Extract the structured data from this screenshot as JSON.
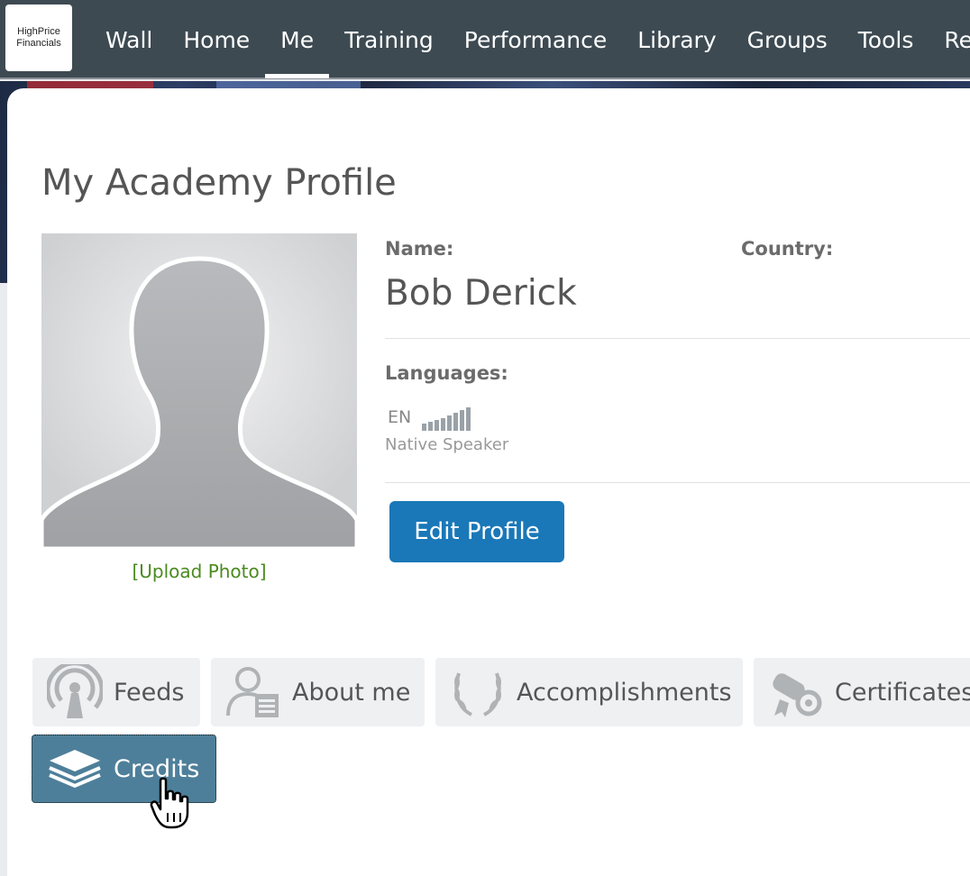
{
  "logo": {
    "line1": "HighPrice",
    "line2": "Financials"
  },
  "nav": {
    "items": [
      {
        "label": "Wall",
        "active": false
      },
      {
        "label": "Home",
        "active": false
      },
      {
        "label": "Me",
        "active": true
      },
      {
        "label": "Training",
        "active": false
      },
      {
        "label": "Performance",
        "active": false
      },
      {
        "label": "Library",
        "active": false
      },
      {
        "label": "Groups",
        "active": false
      },
      {
        "label": "Tools",
        "active": false
      },
      {
        "label": "Rep",
        "active": false
      }
    ]
  },
  "profile": {
    "title": "My Academy Profile",
    "upload_label": "[Upload Photo]",
    "name_label": "Name:",
    "name_value": "Bob Derick",
    "country_label": "Country:",
    "languages_label": "Languages:",
    "language": {
      "code": "EN",
      "level": "Native Speaker",
      "proficiency": "5/5"
    },
    "edit_button": "Edit Profile"
  },
  "tabs": [
    {
      "label": "Feeds",
      "icon": "broadcast-icon",
      "active": false
    },
    {
      "label": "About me",
      "icon": "user-card-icon",
      "active": false
    },
    {
      "label": "Accomplishments",
      "icon": "laurel-icon",
      "active": false
    },
    {
      "label": "Certificates",
      "icon": "diploma-icon",
      "active": false
    },
    {
      "label": "Credits",
      "icon": "layers-icon",
      "active": true
    }
  ],
  "colors": {
    "nav_bg": "#3d4a52",
    "primary_button": "#1a78b8",
    "active_tab": "#4e7f9a",
    "link_green": "#4a8a1f"
  }
}
